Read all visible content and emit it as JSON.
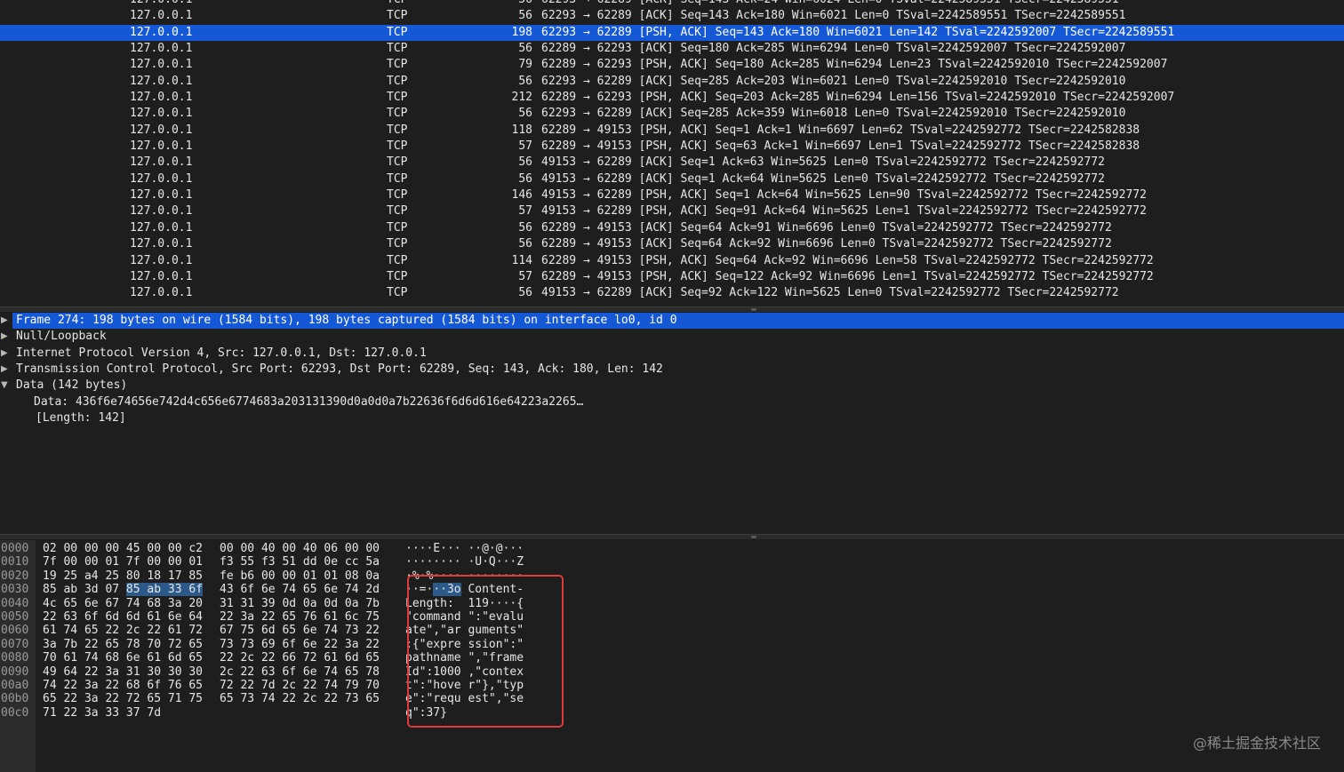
{
  "packets": [
    {
      "src": "127.0.0.1",
      "proto": "TCP",
      "len": "56",
      "info": "62293 → 62289 [ACK] Seq=143 Ack=24 Win=6024 Len=0 TSval=2242589551 TSecr=2242589551",
      "selected": false
    },
    {
      "src": "127.0.0.1",
      "proto": "TCP",
      "len": "56",
      "info": "62293 → 62289 [ACK] Seq=143 Ack=180 Win=6021 Len=0 TSval=2242589551 TSecr=2242589551",
      "selected": false
    },
    {
      "src": "127.0.0.1",
      "proto": "TCP",
      "len": "198",
      "info": "62293 → 62289 [PSH, ACK] Seq=143 Ack=180 Win=6021 Len=142 TSval=2242592007 TSecr=2242589551",
      "selected": true
    },
    {
      "src": "127.0.0.1",
      "proto": "TCP",
      "len": "56",
      "info": "62289 → 62293 [ACK] Seq=180 Ack=285 Win=6294 Len=0 TSval=2242592007 TSecr=2242592007",
      "selected": false
    },
    {
      "src": "127.0.0.1",
      "proto": "TCP",
      "len": "79",
      "info": "62289 → 62293 [PSH, ACK] Seq=180 Ack=285 Win=6294 Len=23 TSval=2242592010 TSecr=2242592007",
      "selected": false
    },
    {
      "src": "127.0.0.1",
      "proto": "TCP",
      "len": "56",
      "info": "62293 → 62289 [ACK] Seq=285 Ack=203 Win=6021 Len=0 TSval=2242592010 TSecr=2242592010",
      "selected": false
    },
    {
      "src": "127.0.0.1",
      "proto": "TCP",
      "len": "212",
      "info": "62289 → 62293 [PSH, ACK] Seq=203 Ack=285 Win=6294 Len=156 TSval=2242592010 TSecr=2242592007",
      "selected": false
    },
    {
      "src": "127.0.0.1",
      "proto": "TCP",
      "len": "56",
      "info": "62293 → 62289 [ACK] Seq=285 Ack=359 Win=6018 Len=0 TSval=2242592010 TSecr=2242592010",
      "selected": false
    },
    {
      "src": "127.0.0.1",
      "proto": "TCP",
      "len": "118",
      "info": "62289 → 49153 [PSH, ACK] Seq=1 Ack=1 Win=6697 Len=62 TSval=2242592772 TSecr=2242582838",
      "selected": false
    },
    {
      "src": "127.0.0.1",
      "proto": "TCP",
      "len": "57",
      "info": "62289 → 49153 [PSH, ACK] Seq=63 Ack=1 Win=6697 Len=1 TSval=2242592772 TSecr=2242582838",
      "selected": false
    },
    {
      "src": "127.0.0.1",
      "proto": "TCP",
      "len": "56",
      "info": "49153 → 62289 [ACK] Seq=1 Ack=63 Win=5625 Len=0 TSval=2242592772 TSecr=2242592772",
      "selected": false
    },
    {
      "src": "127.0.0.1",
      "proto": "TCP",
      "len": "56",
      "info": "49153 → 62289 [ACK] Seq=1 Ack=64 Win=5625 Len=0 TSval=2242592772 TSecr=2242592772",
      "selected": false
    },
    {
      "src": "127.0.0.1",
      "proto": "TCP",
      "len": "146",
      "info": "49153 → 62289 [PSH, ACK] Seq=1 Ack=64 Win=5625 Len=90 TSval=2242592772 TSecr=2242592772",
      "selected": false
    },
    {
      "src": "127.0.0.1",
      "proto": "TCP",
      "len": "57",
      "info": "49153 → 62289 [PSH, ACK] Seq=91 Ack=64 Win=5625 Len=1 TSval=2242592772 TSecr=2242592772",
      "selected": false
    },
    {
      "src": "127.0.0.1",
      "proto": "TCP",
      "len": "56",
      "info": "62289 → 49153 [ACK] Seq=64 Ack=91 Win=6696 Len=0 TSval=2242592772 TSecr=2242592772",
      "selected": false
    },
    {
      "src": "127.0.0.1",
      "proto": "TCP",
      "len": "56",
      "info": "62289 → 49153 [ACK] Seq=64 Ack=92 Win=6696 Len=0 TSval=2242592772 TSecr=2242592772",
      "selected": false
    },
    {
      "src": "127.0.0.1",
      "proto": "TCP",
      "len": "114",
      "info": "62289 → 49153 [PSH, ACK] Seq=64 Ack=92 Win=6696 Len=58 TSval=2242592772 TSecr=2242592772",
      "selected": false
    },
    {
      "src": "127.0.0.1",
      "proto": "TCP",
      "len": "57",
      "info": "62289 → 49153 [PSH, ACK] Seq=122 Ack=92 Win=6696 Len=1 TSval=2242592772 TSecr=2242592772",
      "selected": false
    },
    {
      "src": "127.0.0.1",
      "proto": "TCP",
      "len": "56",
      "info": "49153 → 62289 [ACK] Seq=92 Ack=122 Win=5625 Len=0 TSval=2242592772 TSecr=2242592772",
      "selected": false
    }
  ],
  "details": [
    {
      "text": "Frame 274: 198 bytes on wire (1584 bits), 198 bytes captured (1584 bits) on interface lo0, id 0",
      "arrow": "▶",
      "selected": true
    },
    {
      "text": "Null/Loopback",
      "arrow": "▶",
      "selected": false
    },
    {
      "text": "Internet Protocol Version 4, Src: 127.0.0.1, Dst: 127.0.0.1",
      "arrow": "▶",
      "selected": false
    },
    {
      "text": "Transmission Control Protocol, Src Port: 62293, Dst Port: 62289, Seq: 143, Ack: 180, Len: 142",
      "arrow": "▶",
      "selected": false
    },
    {
      "text": "Data (142 bytes)",
      "arrow": "▼",
      "selected": false
    },
    {
      "text": "Data: 436f6e74656e742d4c656e6774683a203131390d0a0d0a7b22636f6d6d616e64223a2265…",
      "arrow": "",
      "selected": false
    },
    {
      "text": "[Length: 142]",
      "arrow": "",
      "selected": false
    }
  ],
  "bytes": [
    {
      "offset": "0000",
      "hex1": "02 00 00 00 45 00 00 c2",
      "hex2": "00 00 40 00 40 06 00 00",
      "ascii": "····E··· ··@·@···"
    },
    {
      "offset": "0010",
      "hex1": "7f 00 00 01 7f 00 00 01",
      "hex2": "f3 55 f3 51 dd 0e cc 5a",
      "ascii": "········ ·U·Q···Z"
    },
    {
      "offset": "0020",
      "hex1": "19 25 a4 25 80 18 17 85",
      "hex2": "fe b6 00 00 01 01 08 0a",
      "ascii": "·%·%···· ········"
    },
    {
      "offset": "0030",
      "hex1_a": "85 ab 3d 07 ",
      "hex1_hl": "85 ab 33 6f",
      "hex2": "43 6f 6e 74 65 6e 74 2d",
      "ascii_a": "··=·",
      "ascii_hl": "··3o",
      "ascii_b": " Content-"
    },
    {
      "offset": "0040",
      "hex1": "4c 65 6e 67 74 68 3a 20",
      "hex2": "31 31 39 0d 0a 0d 0a 7b",
      "ascii": "Length:  119····{"
    },
    {
      "offset": "0050",
      "hex1": "22 63 6f 6d 6d 61 6e 64",
      "hex2": "22 3a 22 65 76 61 6c 75",
      "ascii": "\"command \":\"evalu"
    },
    {
      "offset": "0060",
      "hex1": "61 74 65 22 2c 22 61 72",
      "hex2": "67 75 6d 65 6e 74 73 22",
      "ascii": "ate\",\"ar guments\""
    },
    {
      "offset": "0070",
      "hex1": "3a 7b 22 65 78 70 72 65",
      "hex2": "73 73 69 6f 6e 22 3a 22",
      "ascii": ":{\"expre ssion\":\""
    },
    {
      "offset": "0080",
      "hex1": "70 61 74 68 6e 61 6d 65",
      "hex2": "22 2c 22 66 72 61 6d 65",
      "ascii": "pathname \",\"frame"
    },
    {
      "offset": "0090",
      "hex1": "49 64 22 3a 31 30 30 30",
      "hex2": "2c 22 63 6f 6e 74 65 78",
      "ascii": "Id\":1000 ,\"contex"
    },
    {
      "offset": "00a0",
      "hex1": "74 22 3a 22 68 6f 76 65",
      "hex2": "72 22 7d 2c 22 74 79 70",
      "ascii": "t\":\"hove r\"},\"typ"
    },
    {
      "offset": "00b0",
      "hex1": "65 22 3a 22 72 65 71 75",
      "hex2": "65 73 74 22 2c 22 73 65",
      "ascii": "e\":\"requ est\",\"se"
    },
    {
      "offset": "00c0",
      "hex1": "71 22 3a 33 37 7d",
      "hex2": "",
      "ascii": "q\":37}"
    }
  ],
  "watermark": "@稀土掘金技术社区",
  "colors": {
    "selection": "#1558d6",
    "background": "#1e1e1e",
    "annotation_box": "#e03b3b"
  }
}
